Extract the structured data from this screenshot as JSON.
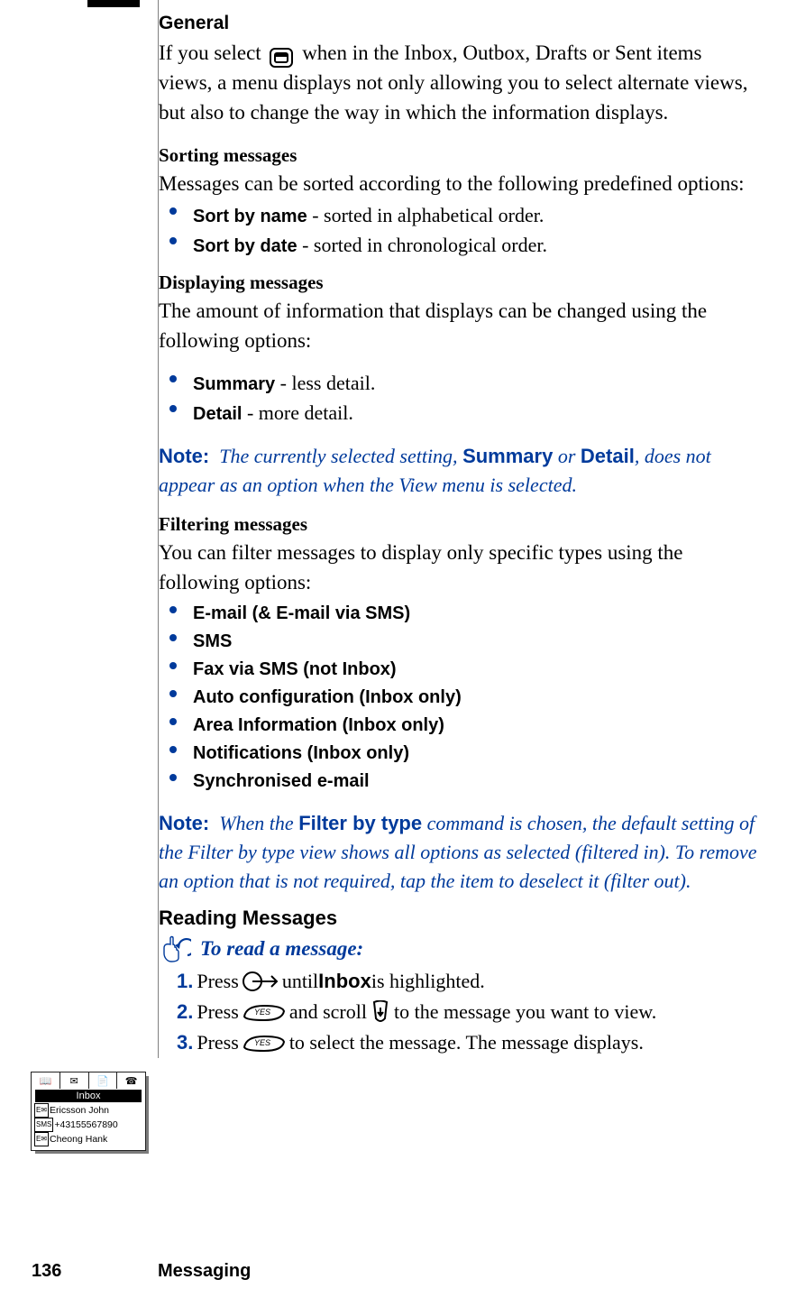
{
  "general": {
    "heading": "General",
    "para": "If you select        when in the Inbox, Outbox, Drafts or Sent items views, a menu displays not only allowing you to select alternate views, but also to change the way in which the information displays."
  },
  "sorting": {
    "heading": "Sorting messages",
    "para": "Messages can be sorted according to the following predefined options:",
    "items": [
      {
        "label": "Sort by name",
        "tail": " - sorted in alphabetical order."
      },
      {
        "label": "Sort by date",
        "tail": " - sorted in chronological order."
      }
    ]
  },
  "displaying": {
    "heading": "Displaying messages",
    "para": "The amount of information that displays can be changed using the following options:",
    "items": [
      {
        "label": "Summary",
        "tail": " - less detail."
      },
      {
        "label": "Detail",
        "tail": " - more detail."
      }
    ]
  },
  "note1": {
    "label": "Note:",
    "pre": "The currently selected setting, ",
    "emb1": "Summary",
    "mid": " or ",
    "emb2": "Detail",
    "post": ", does not appear as an option when the View menu is selected."
  },
  "filtering": {
    "heading": "Filtering messages",
    "para": "You can filter messages to display only specific types using the following options:",
    "items": [
      "E-mail (& E-mail via SMS)",
      "SMS",
      "Fax via SMS (not Inbox)",
      "Auto configuration (Inbox only)",
      "Area Information (Inbox only)",
      "Notifications (Inbox only)",
      "Synchronised e-mail"
    ]
  },
  "note2": {
    "label": "Note:",
    "pre": "When the ",
    "emb1": "Filter by type",
    "post": " command is chosen, the default setting of the Filter by type view shows all options as selected (filtered in). To remove an option that is not required, tap the item to deselect it (filter out)."
  },
  "reading": {
    "heading": "Reading Messages",
    "proc_title": "To read a message:",
    "steps": {
      "s1": {
        "num": "1.",
        "pre": "Press ",
        "post_a": " until ",
        "emb": "Inbox",
        "post_b": " is highlighted."
      },
      "s2": {
        "num": "2.",
        "pre": "Press ",
        "mid": " and scroll ",
        "post": " to the message you want to view."
      },
      "s3": {
        "num": "3.",
        "pre": "Press ",
        "post": " to select the message. The message displays."
      }
    }
  },
  "phone_thumb": {
    "selected": "Inbox",
    "rows": [
      {
        "tag": "E✉",
        "text": "Ericsson John"
      },
      {
        "tag": "SMS",
        "text": "+43155567890"
      },
      {
        "tag": "E✉",
        "text": "Cheong Hank"
      }
    ]
  },
  "footer": {
    "page_number": "136",
    "chapter": "Messaging"
  }
}
